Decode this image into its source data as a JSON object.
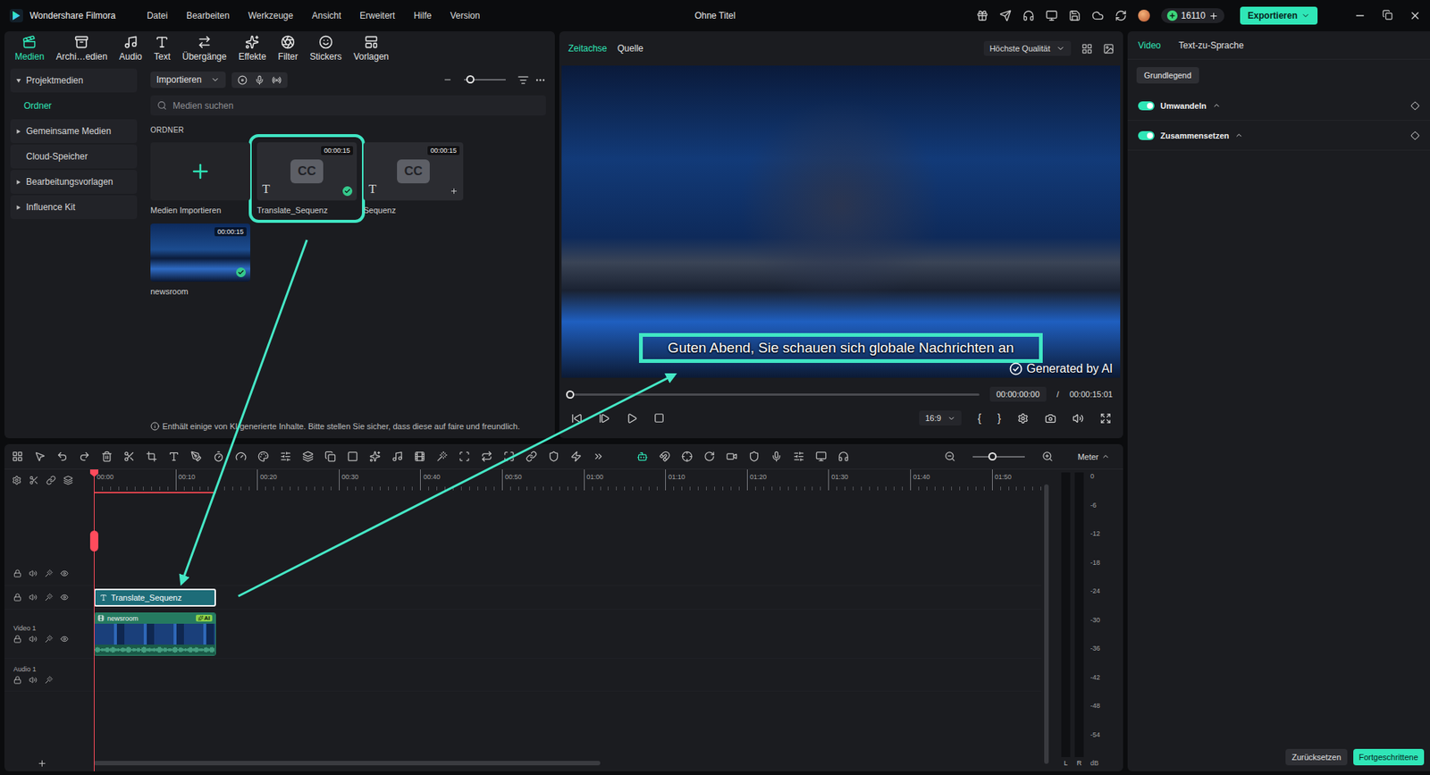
{
  "app": {
    "name": "Wondershare Filmora",
    "title": "Ohne Titel",
    "credits": "16110",
    "export": "Exportieren"
  },
  "menu": [
    "Datei",
    "Bearbeiten",
    "Werkzeuge",
    "Ansicht",
    "Erweitert",
    "Hilfe",
    "Version"
  ],
  "media_tabs": [
    {
      "label": "Medien",
      "selected": true
    },
    {
      "label": "Archi…edien",
      "selected": false
    },
    {
      "label": "Audio",
      "selected": false
    },
    {
      "label": "Text",
      "selected": false
    },
    {
      "label": "Übergänge",
      "selected": false
    },
    {
      "label": "Effekte",
      "selected": false
    },
    {
      "label": "Filter",
      "selected": false
    },
    {
      "label": "Stickers",
      "selected": false
    },
    {
      "label": "Vorlagen",
      "selected": false
    }
  ],
  "sidebar": [
    {
      "label": "Projektmedien",
      "kind": "group",
      "expanded": true,
      "selected": false
    },
    {
      "label": "Ordner",
      "kind": "child",
      "expanded": false,
      "selected": true
    },
    {
      "label": "Gemeinsame Medien",
      "kind": "group",
      "expanded": false,
      "selected": false
    },
    {
      "label": "Cloud-Speicher",
      "kind": "plain",
      "expanded": false,
      "selected": false
    },
    {
      "label": "Bearbeitungsvorlagen",
      "kind": "group",
      "expanded": false,
      "selected": false
    },
    {
      "label": "Influence Kit",
      "kind": "group",
      "expanded": false,
      "selected": false
    }
  ],
  "media": {
    "import_button": "Importieren",
    "thumb_size": {
      "level": 0.14
    },
    "search_placeholder": "Medien suchen",
    "section": "ORDNER",
    "items": [
      {
        "name": "Medien Importieren",
        "kind": "import",
        "duration": "",
        "badge": "",
        "glyph": "",
        "used": false,
        "selected": false,
        "highlighted": false
      },
      {
        "name": "Translate_Sequenz",
        "kind": "subtitle",
        "duration": "00:00:15",
        "badge": "CC",
        "glyph": "T",
        "used": true,
        "selected": true,
        "highlighted": true
      },
      {
        "name": "Sequenz",
        "kind": "subtitle",
        "duration": "00:00:15",
        "badge": "CC",
        "glyph": "T",
        "used": false,
        "selected": false,
        "highlighted": false
      },
      {
        "name": "newsroom",
        "kind": "video",
        "duration": "00:00:15",
        "badge": "",
        "glyph": "",
        "used": true,
        "selected": false,
        "highlighted": false
      }
    ],
    "notice": "Enthält einige von KI generierte Inhalte. Bitte stellen Sie sicher, dass diese auf faire und freundlich."
  },
  "preview": {
    "tabs": [
      {
        "label": "Zeitachse",
        "selected": true
      },
      {
        "label": "Quelle",
        "selected": false
      }
    ],
    "quality": "Höchste Qualität",
    "subtitle": {
      "text": "Guten Abend, Sie schauen sich globale Nachrichten an",
      "highlighted": true
    },
    "watermark": "Generated by AI",
    "progress": 0,
    "current_time": "00:00:00:00",
    "separator": "/",
    "total_time": "00:00:15:01",
    "ratio": "16:9",
    "mark_in": "{",
    "mark_out": "}"
  },
  "inspector": {
    "tabs": [
      {
        "label": "Video",
        "selected": true
      },
      {
        "label": "Text-zu-Sprache",
        "selected": false
      }
    ],
    "sections": [
      {
        "label": "Grundlegend",
        "selected": true
      }
    ],
    "toggles": [
      {
        "label": "Umwandeln",
        "on": true
      },
      {
        "label": "Zusammensetzen",
        "on": true
      }
    ],
    "reset": "Zurücksetzen",
    "advanced": "Fortgeschrittene"
  },
  "timeline": {
    "meter_mode": "Meter",
    "zoom": {
      "level": 0.37
    },
    "ruler": [
      "00:00",
      "00:10",
      "00:20",
      "00:30",
      "00:40",
      "00:50",
      "01:00",
      "01:10",
      "01:20",
      "01:30",
      "01:40",
      "01:50"
    ],
    "tracks": [
      {
        "label": "",
        "kind": "overlay",
        "clips": []
      },
      {
        "label": "",
        "kind": "title",
        "clips": [
          {
            "name": "Translate_Sequenz",
            "selected": true,
            "badge": ""
          }
        ]
      },
      {
        "label": "Video 1",
        "kind": "video",
        "clips": [
          {
            "name": "newsroom",
            "selected": false,
            "badge": "AI"
          }
        ]
      },
      {
        "label": "Audio 1",
        "kind": "audio",
        "clips": []
      }
    ],
    "meter": {
      "scale": [
        "0",
        "-6",
        "-12",
        "-18",
        "-24",
        "-30",
        "-36",
        "-42",
        "-48",
        "-54"
      ],
      "unit": "dB",
      "channels": [
        {
          "label": "L",
          "level": 0
        },
        {
          "label": "R",
          "level": 0
        }
      ]
    }
  }
}
